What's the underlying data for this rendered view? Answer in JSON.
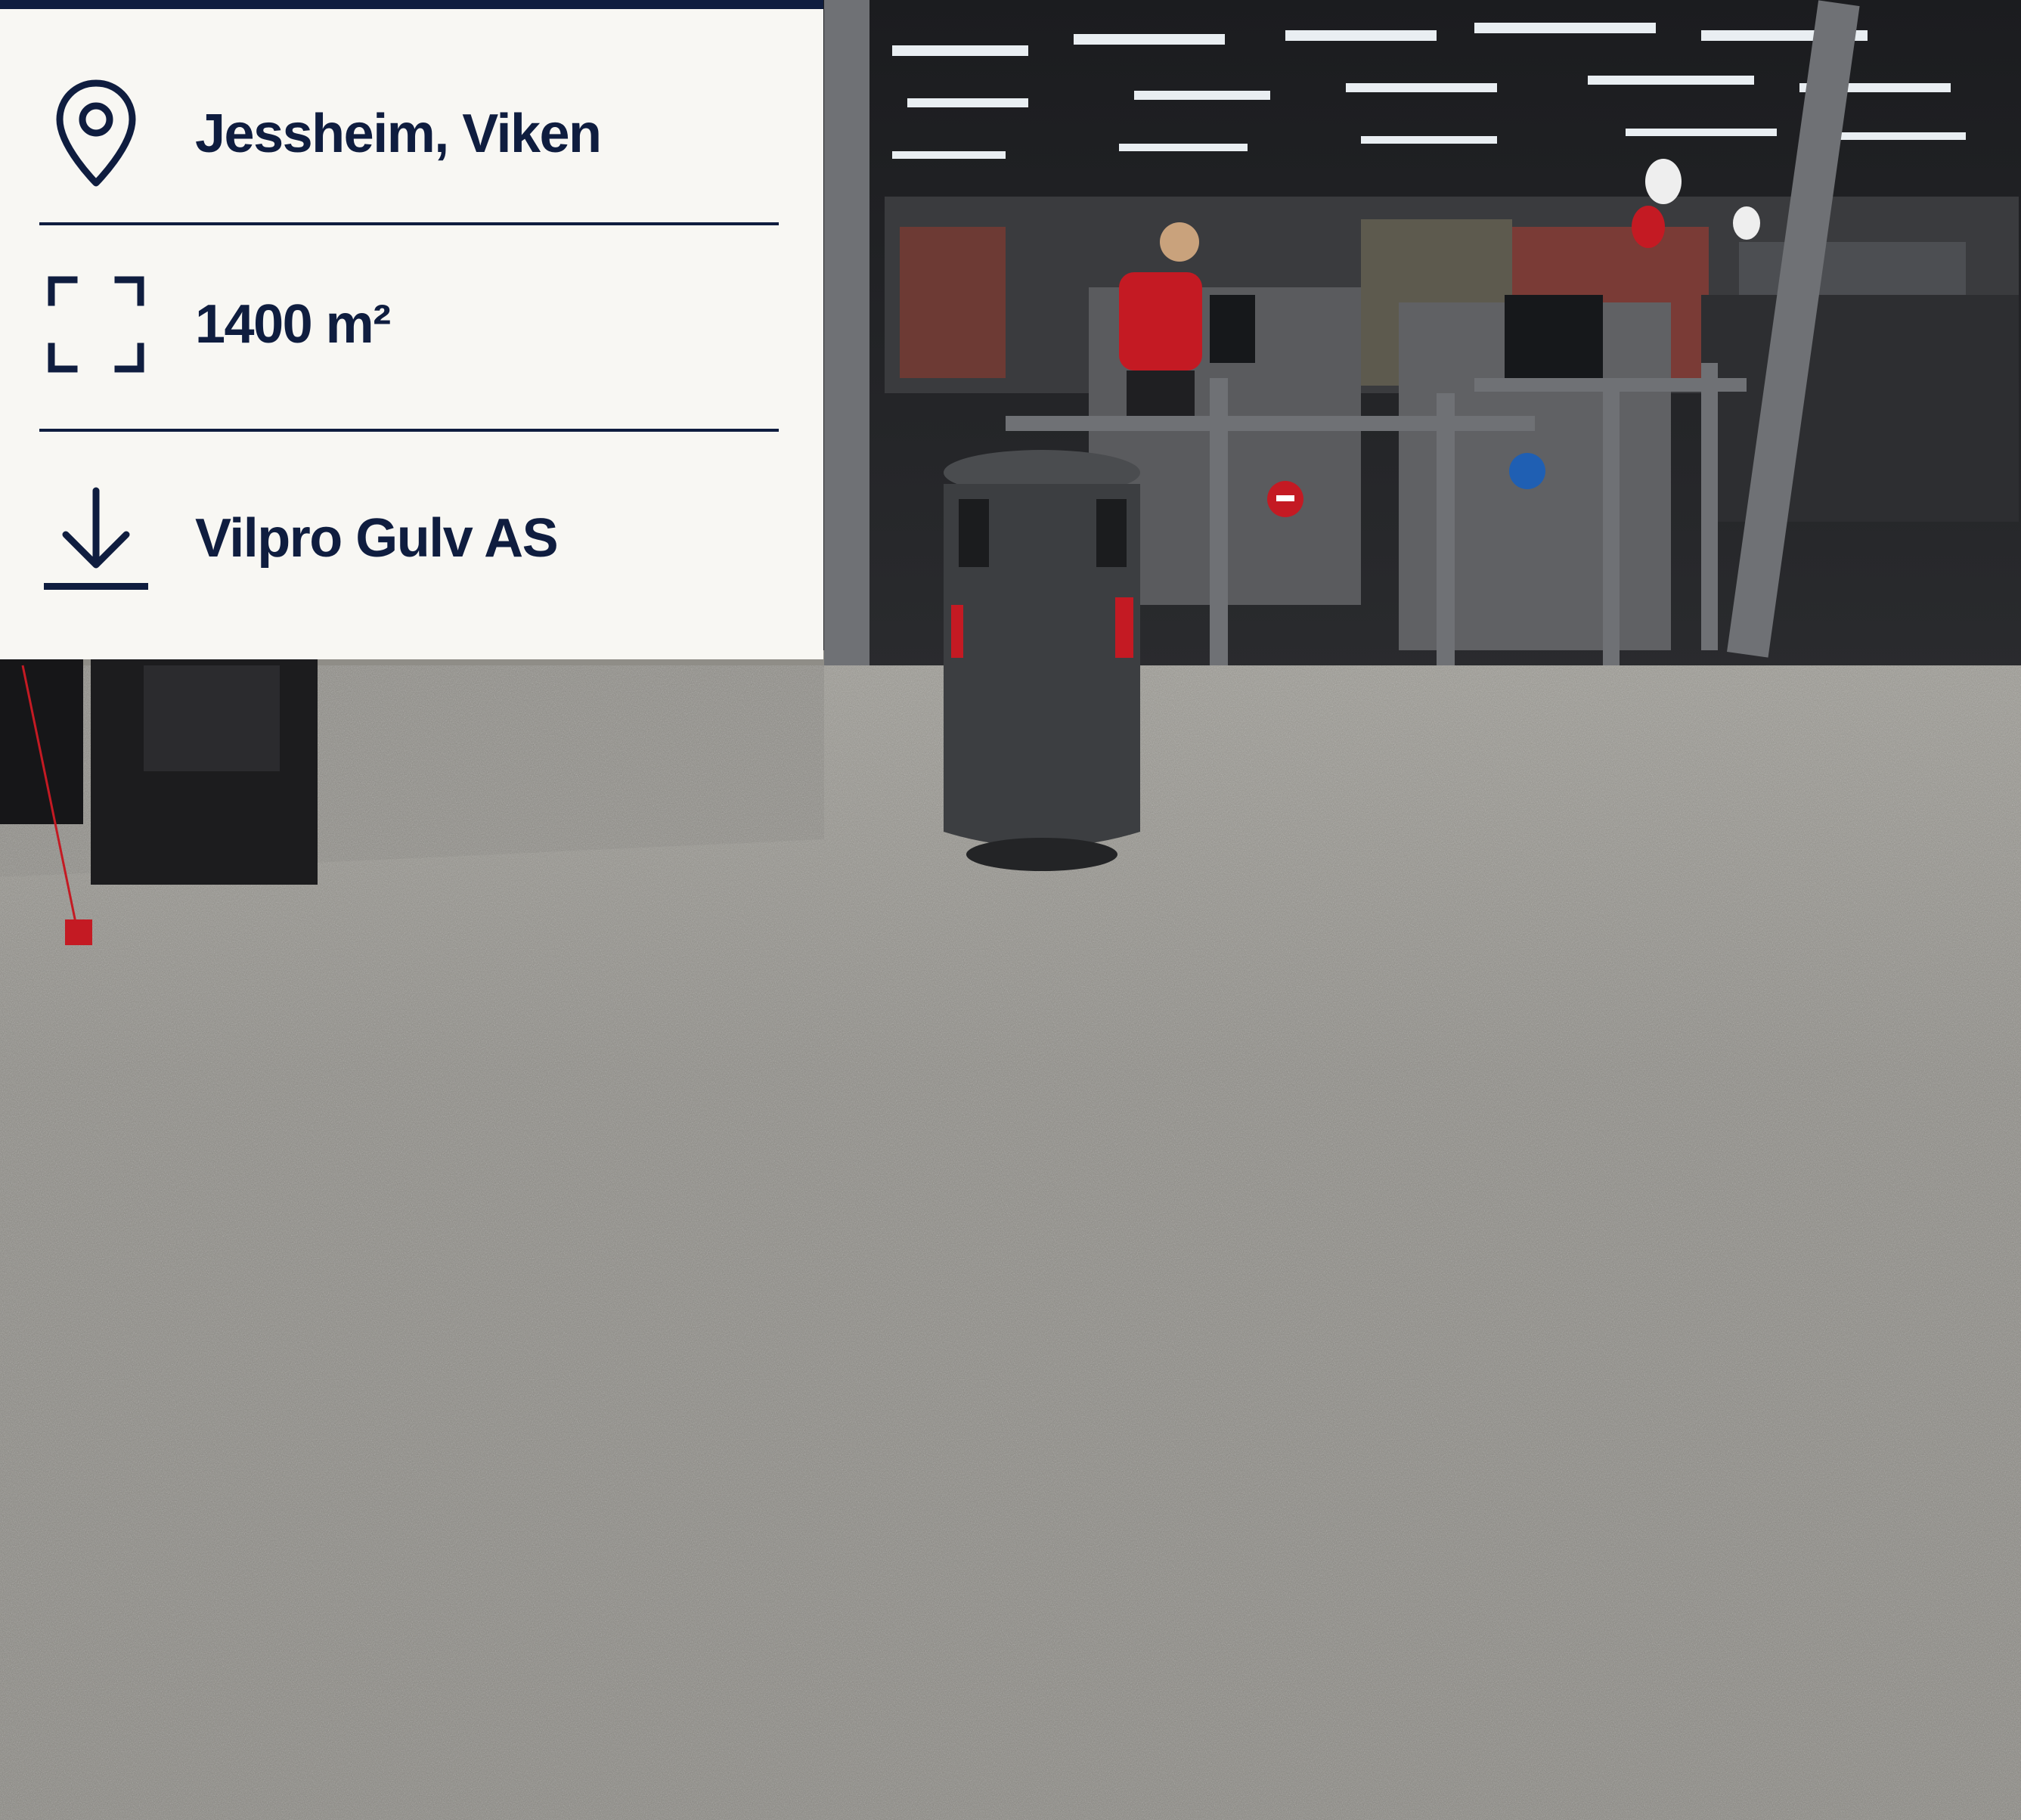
{
  "info_card": {
    "location": {
      "icon": "map-pin-icon",
      "text": "Jessheim, Viken"
    },
    "area": {
      "icon": "area-frame-icon",
      "text": "1400 m²"
    },
    "company": {
      "icon": "arrow-down-icon",
      "text": "Vilpro Gulv AS"
    }
  },
  "colors": {
    "navy": "#0f1d3f",
    "card_background": "#f8f7f3",
    "floor_grey": "#8c8a84"
  }
}
